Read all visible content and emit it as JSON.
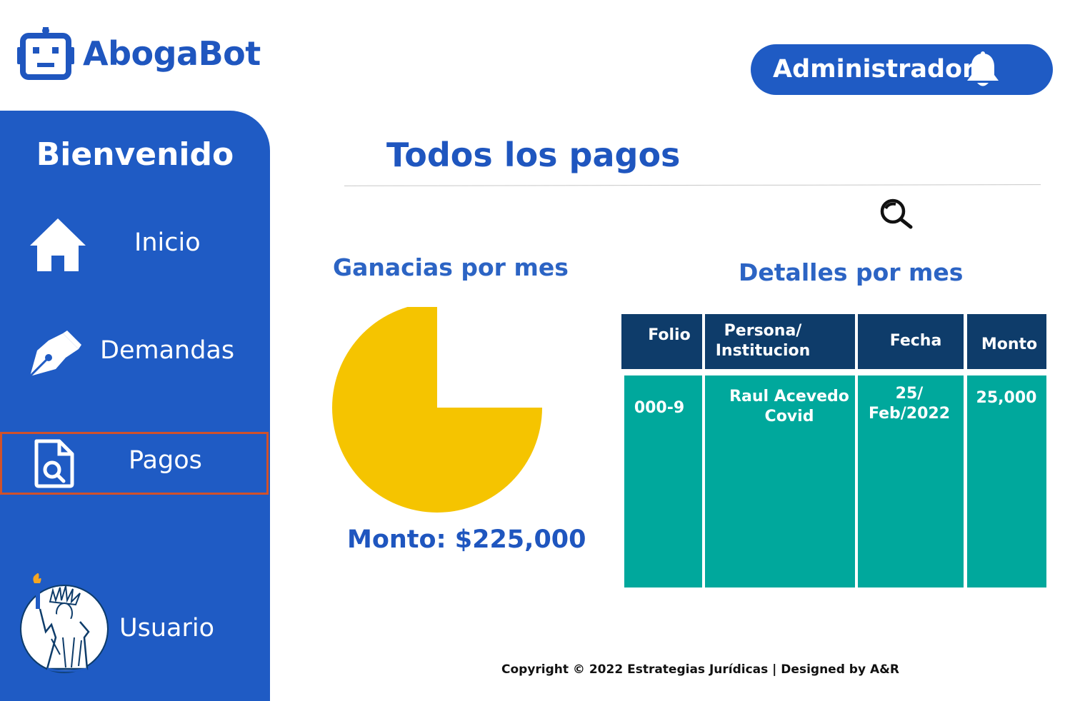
{
  "app": {
    "title": "AbogaBot"
  },
  "header": {
    "user_label": "Administrador"
  },
  "sidebar": {
    "welcome": "Bienvenido",
    "items": [
      {
        "label": "Inicio",
        "icon": "home-icon"
      },
      {
        "label": "Demandas",
        "icon": "pen-nib-icon"
      },
      {
        "label": "Pagos",
        "icon": "document-search-icon",
        "selected": true
      },
      {
        "label": "Usuario",
        "icon": "statue-of-liberty-avatar"
      }
    ]
  },
  "main": {
    "title": "Todos los pagos",
    "chart_title": "Ganacias por mes",
    "total": "Monto: $225,000",
    "table_title": "Detalles por mes",
    "table": {
      "headers": [
        "Folio",
        "Persona/ Institucion",
        "Fecha",
        "Monto"
      ],
      "header_lines": [
        [
          "Folio"
        ],
        [
          "Persona/",
          "Institucion"
        ],
        [
          "Fecha"
        ],
        [
          "Monto"
        ]
      ],
      "rows": [
        {
          "folio": "000-9",
          "persona": [
            "Raul Acevedo",
            "Covid"
          ],
          "fecha": [
            "25/",
            "Feb/2022"
          ],
          "monto": "25,000"
        }
      ]
    }
  },
  "footer": {
    "text": "Copyright © 2022 Estrategias Jurídicas | Designed by A&R"
  },
  "colors": {
    "brand_blue": "#1f5bc4",
    "title_blue": "#1f56bf",
    "table_header": "#0e3c6a",
    "table_body": "#00a89c",
    "pie_fill": "#f5c400",
    "selected_border": "#d0512b"
  },
  "chart_data": {
    "type": "pie",
    "values": [
      75
    ],
    "unit": "percent of circle filled (one slice, remaining wedge empty)",
    "color": "#f5c400"
  }
}
